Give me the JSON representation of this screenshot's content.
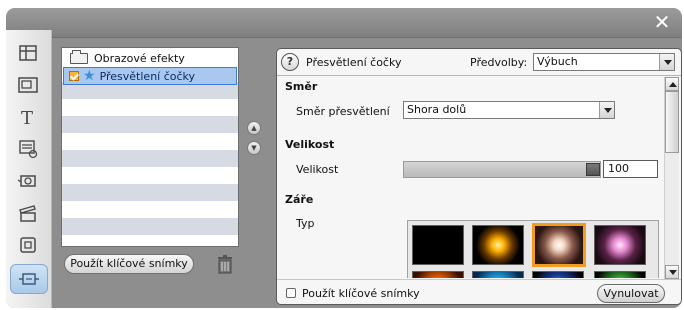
{
  "window": {
    "close_icon": "close-icon"
  },
  "toolbar": {
    "tools": [
      {
        "icon": "storyboard-icon"
      },
      {
        "icon": "picture-in-picture-icon"
      },
      {
        "icon": "text-icon"
      },
      {
        "icon": "menu-icon"
      },
      {
        "icon": "camera-icon"
      },
      {
        "icon": "clapper-icon"
      },
      {
        "icon": "square-icon"
      },
      {
        "icon": "effects-icon",
        "active": true
      }
    ]
  },
  "effects_list": {
    "category_label": "Obrazové efekty",
    "selected_item": "Přesvětlení čočky"
  },
  "buttons": {
    "keyframes": "Použít klíčové snímky",
    "reset": "Vynulovat"
  },
  "effect_panel": {
    "title": "Přesvětlení čočky",
    "presets_label": "Předvolby:",
    "presets_value": "Výbuch",
    "direction_section": "Směr",
    "direction_label": "Směr přesvětlení",
    "direction_value": "Shora dolů",
    "size_section": "Velikost",
    "size_label": "Velikost",
    "size_value": "100",
    "glow_section": "Záře",
    "type_label": "Typ",
    "use_keyframes": "Použít klíčové snímky"
  },
  "colors": {
    "selection": "#a9c8f0",
    "accent": "#f29c1f"
  }
}
